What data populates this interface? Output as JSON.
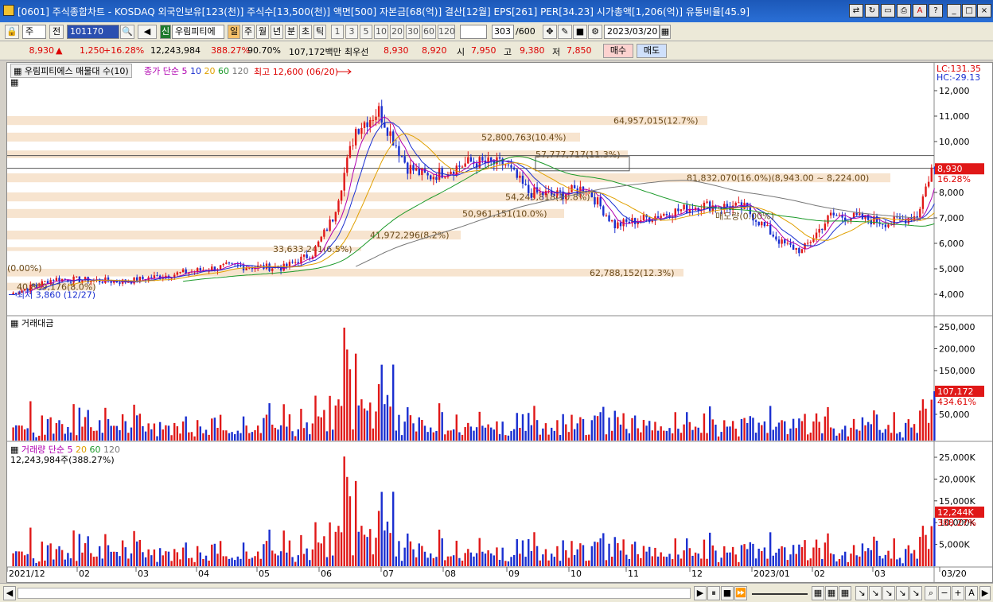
{
  "title": "[0601] 주식종합차트 - KOSDAQ 외국인보유[123(천)] 주식수[13,500(천)] 액면[500] 자본금[68(억)] 결산[12월] EPS[261] PER[34.23] 시가총액[1,206(억)] 유통비율[45.9]",
  "toolbar": {
    "mode": "주",
    "prev": "전",
    "code": "101170",
    "stock_name": "우림피티에",
    "sel": "일",
    "periods": [
      "주",
      "월",
      "년",
      "분",
      "초",
      "틱"
    ],
    "nums": [
      "1",
      "3",
      "5",
      "10",
      "20",
      "30",
      "60",
      "120"
    ],
    "count": "303",
    "total": "/600",
    "date": "2023/03/20"
  },
  "quote": {
    "price": "8,930",
    "change": "1,250",
    "change_pct": "+16.28%",
    "volume": "12,243,984",
    "vol_pct": "388.27%",
    "ratio": "90.70%",
    "amount": "107,172백만",
    "best_label": "최우선",
    "best1": "8,930",
    "best2": "8,920",
    "open_label": "시",
    "open": "7,950",
    "high_label": "고",
    "high": "9,380",
    "low_label": "저",
    "low": "7,850",
    "buy": "매수",
    "sell": "매도"
  },
  "price_pane": {
    "title": "우림피티에스 매물대 수(10)",
    "ma_label": "종가 단순",
    "ma": [
      "5",
      "10",
      "20",
      "60",
      "120"
    ],
    "lc": "LC:131.35",
    "hc": "HC:-29.13",
    "high_note": "최고 12,600 (06/20)",
    "low_note": "최저 3,860 (12/27)",
    "last_price": "8,930",
    "last_pct": "16.28%",
    "mid_note": "매도량(0.00%)",
    "left_note": "(0.00%)",
    "ticks": [
      "12,000",
      "11,000",
      "10,000",
      "9,000",
      "8,000",
      "7,000",
      "6,000",
      "5,000",
      "4,000"
    ],
    "profile": [
      "64,957,015(12.7%)",
      "52,800,763(10.4%)",
      "57,777,717(11.3%)",
      "81,832,070(16.0%)(8,943.00 ~ 8,224.00)",
      "54,245,818(10.8%)",
      "50,961,151(10.0%)",
      "41,972,296(8.2%)",
      "33,633,241(6.5%)",
      "62,788,152(12.3%)",
      "40,809,176(8.0%)"
    ]
  },
  "amount_pane": {
    "title": "거래대금",
    "ticks": [
      "250,000",
      "200,000",
      "150,000",
      "100,000",
      "50,000"
    ],
    "last": "107,172",
    "last_pct": "434.61%"
  },
  "volume_pane": {
    "title": "거래량 단순",
    "ma": [
      "5",
      "20",
      "60",
      "120"
    ],
    "sub": "12,243,984주(388.27%)",
    "ticks": [
      "25,000K",
      "20,000K",
      "15,000K",
      "10,000K",
      "5,000K"
    ],
    "last": "12,244K",
    "last_pct": "388.27%"
  },
  "xaxis": [
    "2021/12",
    "02",
    "03",
    "04",
    "05",
    "06",
    "07",
    "08",
    "09",
    "10",
    "11",
    "12",
    "2023/01",
    "02",
    "03",
    "03/20"
  ],
  "colors": {
    "up": "#e01818",
    "down": "#1a2fd0",
    "band": "#f7e4cf"
  }
}
